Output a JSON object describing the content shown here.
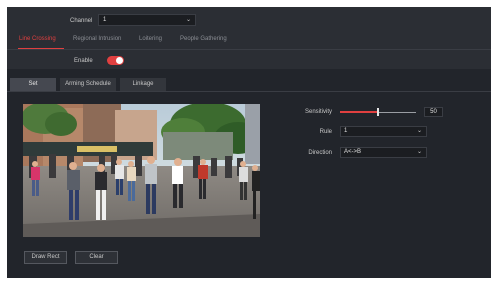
{
  "channel": {
    "label": "Channel",
    "value": "1"
  },
  "tabs": [
    {
      "label": "Line Crossing",
      "active": true
    },
    {
      "label": "Regional Intrusion",
      "active": false
    },
    {
      "label": "Loitering",
      "active": false
    },
    {
      "label": "People Gathering",
      "active": false
    }
  ],
  "enable": {
    "label": "Enable",
    "on": true
  },
  "subtabs": [
    {
      "label": "Set",
      "active": true
    },
    {
      "label": "Arming Schedule",
      "active": false
    },
    {
      "label": "Linkage",
      "active": false
    }
  ],
  "settings": {
    "sensitivity": {
      "label": "Sensitivity",
      "value": "50",
      "level": 0.5
    },
    "rule": {
      "label": "Rule",
      "value": "1"
    },
    "direction": {
      "label": "Direction",
      "value": "A<->B"
    }
  },
  "buttons": {
    "draw_rect": "Draw Rect",
    "clear": "Clear"
  },
  "colors": {
    "accent": "#e04040",
    "background": "#22252b",
    "panel": "#2b2e34"
  },
  "icons": {
    "dropdown": "chevron-down-icon"
  }
}
